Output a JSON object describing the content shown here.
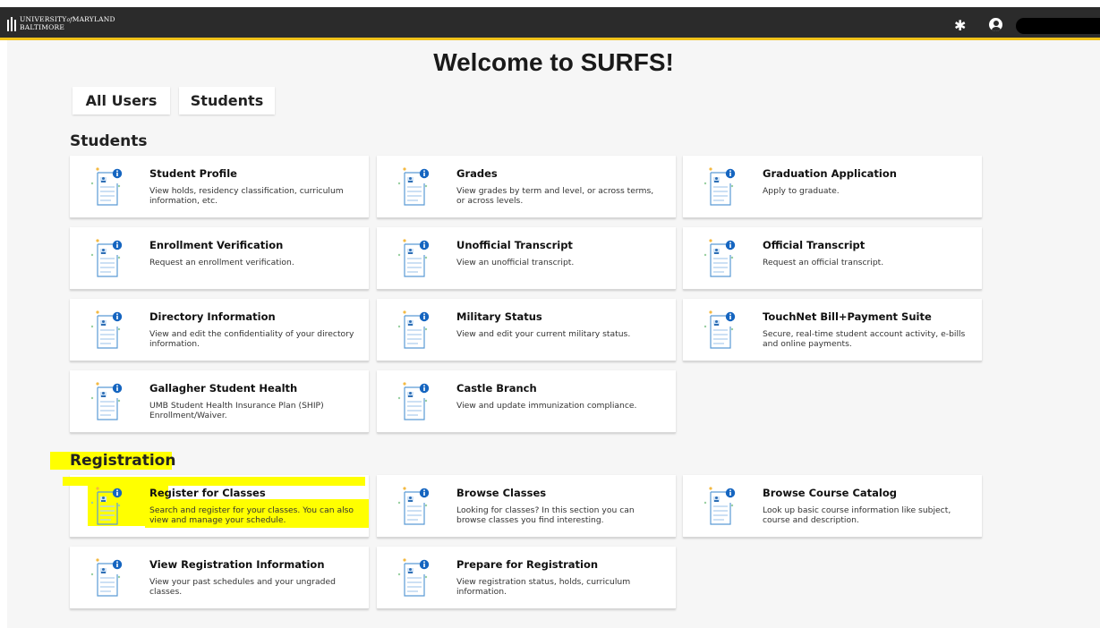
{
  "header": {
    "logo_line1": "UNIVERSITY",
    "logo_of": "of",
    "logo_line1b": "MARYLAND",
    "logo_line2": "BALTIMORE",
    "settings_icon": "gear-icon",
    "user_icon": "user-circle-icon"
  },
  "page": {
    "title": "Welcome to SURFS!"
  },
  "tabs": [
    {
      "label": "All Users"
    },
    {
      "label": "Students"
    }
  ],
  "sections": {
    "students": {
      "heading": "Students",
      "cards": [
        {
          "title": "Student Profile",
          "desc": "View holds, residency classification, curriculum information, etc."
        },
        {
          "title": "Grades",
          "desc": "View grades by term and level, or across terms, or across levels."
        },
        {
          "title": "Graduation Application",
          "desc": "Apply to graduate."
        },
        {
          "title": "Enrollment Verification",
          "desc": "Request an enrollment verification."
        },
        {
          "title": "Unofficial Transcript",
          "desc": "View an unofficial transcript."
        },
        {
          "title": "Official Transcript",
          "desc": "Request an official transcript."
        },
        {
          "title": "Directory Information",
          "desc": "View and edit the confidentiality of your directory information."
        },
        {
          "title": "Military Status",
          "desc": "View and edit your current military status."
        },
        {
          "title": "TouchNet Bill+Payment Suite",
          "desc": "Secure, real-time student account activity, e-bills and online payments."
        },
        {
          "title": "Gallagher Student Health",
          "desc": "UMB Student Health Insurance Plan (SHIP) Enrollment/Waiver."
        },
        {
          "title": "Castle Branch",
          "desc": "View and update immunization compliance."
        }
      ]
    },
    "registration": {
      "heading": "Registration",
      "cards": [
        {
          "title": "Register for Classes",
          "desc": "Search and register for your classes. You can also view and manage your schedule."
        },
        {
          "title": "Browse Classes",
          "desc": "Looking for classes? In this section you can browse classes you find interesting."
        },
        {
          "title": "Browse Course Catalog",
          "desc": "Look up basic course information like subject, course and description."
        },
        {
          "title": "View Registration Information",
          "desc": "View your past schedules and your ungraded classes."
        },
        {
          "title": "Prepare for Registration",
          "desc": "View registration status, holds, curriculum information."
        }
      ]
    }
  },
  "colors": {
    "header_bg": "#2b2b2b",
    "accent": "#f0c21a",
    "highlight": "#ffff00",
    "info_badge": "#1565c0"
  }
}
